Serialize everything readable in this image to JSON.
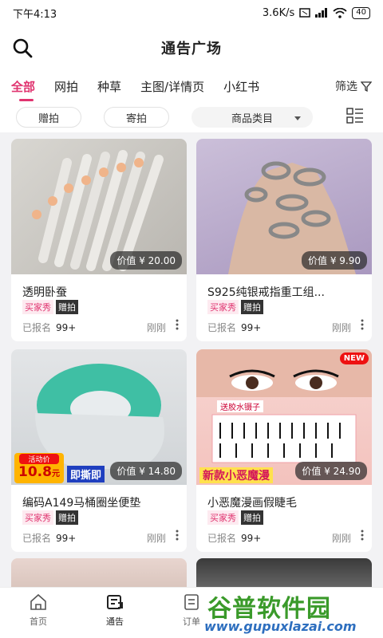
{
  "status": {
    "time": "下午4:13",
    "speed": "3.6K/s",
    "battery": "40"
  },
  "header": {
    "title": "通告广场"
  },
  "tabs": [
    {
      "label": "全部",
      "active": true
    },
    {
      "label": "网拍"
    },
    {
      "label": "种草"
    },
    {
      "label": "主图/详情页"
    },
    {
      "label": "小红书"
    }
  ],
  "filter_label": "筛选",
  "subfilters": {
    "gift": "赠拍",
    "send": "寄拍",
    "category": "商品类目"
  },
  "cards": [
    {
      "title": "透明卧蚕",
      "price": "价值 ¥ 20.00",
      "tag1": "买家秀",
      "tag2": "赠拍",
      "signed_label": "已报名",
      "signed": "99+",
      "time": "刚刚"
    },
    {
      "title": "S925纯银戒指重工组...",
      "price": "价值 ¥ 9.90",
      "tag1": "买家秀",
      "tag2": "赠拍",
      "signed_label": "已报名",
      "signed": "99+",
      "time": "刚刚"
    },
    {
      "title": "编码A149马桶圈坐便垫",
      "price": "价值 ¥ 14.80",
      "tag1": "买家秀",
      "tag2": "赠拍",
      "signed_label": "已报名",
      "signed": "99+",
      "time": "刚刚",
      "img_text": {
        "promo": "活动价",
        "price_big": "10.8",
        "unit": "元",
        "banner": "即撕即"
      }
    },
    {
      "title": "小恶魔漫画假睫毛",
      "price": "价值 ¥ 24.90",
      "tag1": "买家秀",
      "tag2": "赠拍",
      "signed_label": "已报名",
      "signed": "99+",
      "time": "刚刚",
      "img_text": {
        "new": "NEW",
        "banner": "新款小恶魔漫",
        "sub": "送胶水镊子"
      }
    }
  ],
  "nav": [
    {
      "label": "首页"
    },
    {
      "label": "通告",
      "active": true
    },
    {
      "label": "订单"
    }
  ],
  "watermark": {
    "brand": "谷普软件园",
    "url": "www.gupuxlazai.com"
  },
  "colors": {
    "accent": "#e0336f",
    "tag_bg": "#fdeaf0",
    "watermark_green": "#3a9a2a",
    "watermark_blue": "#2e6fbf"
  }
}
